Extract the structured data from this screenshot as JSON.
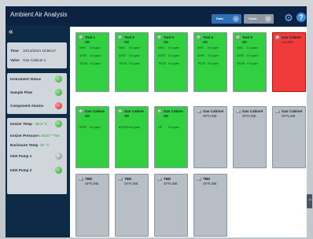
{
  "app": {
    "title": "Ambient Air Analysis"
  },
  "toolbar": {
    "data_label": "Data",
    "chart_label": "Chart"
  },
  "sidebar": {
    "collapse_glyph": "«",
    "time_label": "Time",
    "time_value": "10/13/2024 15:58:47",
    "valve_label": "Valve",
    "valve_value": "Gas Cabinet 1",
    "indicators": [
      {
        "label": "Instrument Status",
        "state": "green"
      },
      {
        "label": "Sample Flow",
        "state": "green"
      },
      {
        "label": "Component Alarms",
        "state": "red"
      }
    ],
    "ionizer_temp_label": "Ionizer Temp",
    "ionizer_temp_value": "88.8 °C",
    "ionizer_pressure_label": "Ionizer Pressure",
    "ionizer_pressure_value": "1.9x10⁻⁶ Torr",
    "enclosure_temp_label": "Enclosure Temp",
    "enclosure_temp_value": "35 °C",
    "pumps": [
      {
        "label": "Inlet Pump 1",
        "state": "grey"
      },
      {
        "label": "Inlet Pump 2",
        "state": "green"
      }
    ]
  },
  "tiles": [
    {
      "name": "Tool 1",
      "status": "OK",
      "color": "green",
      "rows": [
        {
          "name": "NH3",
          "value": "0.0 ppm"
        },
        {
          "name": "ATEF",
          "value": "0.0 ppm"
        },
        {
          "name": "TEOS",
          "value": "0.0 ppm"
        }
      ]
    },
    {
      "name": "Tool 2",
      "status": "OK",
      "color": "green",
      "rows": [
        {
          "name": "NH3",
          "value": "0.0 ppm"
        },
        {
          "name": "ATEF",
          "value": "0.0 ppm"
        },
        {
          "name": "TEOS",
          "value": "0.0 ppm"
        }
      ]
    },
    {
      "name": "Tool 3",
      "status": "OK",
      "color": "green",
      "rows": [
        {
          "name": "NH3",
          "value": "0.0 ppm"
        },
        {
          "name": "ATEF",
          "value": "0.0 ppm"
        },
        {
          "name": "TEOS",
          "value": "0.0 ppm"
        }
      ]
    },
    {
      "name": "Tool 4",
      "status": "OK",
      "color": "green",
      "rows": [
        {
          "name": "NH3",
          "value": "0.0 ppm"
        },
        {
          "name": "ATEF",
          "value": "0.0 ppm"
        },
        {
          "name": "TEOS",
          "value": "0.0 ppm"
        }
      ]
    },
    {
      "name": "Tool 5",
      "status": "OK",
      "color": "green",
      "rows": [
        {
          "name": "NH3",
          "value": "0.0 ppm"
        },
        {
          "name": "ATEF",
          "value": "0.0 ppm"
        },
        {
          "name": "TEOS",
          "value": "0.0 ppm"
        }
      ]
    },
    {
      "name": "Gas Cabine",
      "status": "ALARM",
      "color": "red",
      "rows": []
    },
    {
      "name": "Gas Cabine",
      "status": "OK",
      "color": "green",
      "rows": [
        {
          "name": "ATEF",
          "value": "0.0 ppm"
        }
      ]
    },
    {
      "name": "Gas Cabine",
      "status": "OK",
      "color": "green",
      "rows": [
        {
          "name": "ATEOS",
          "value": "0.0 ppm"
        }
      ]
    },
    {
      "name": "Gas Cabine",
      "status": "OK",
      "color": "green",
      "rows": [
        {
          "name": "HF",
          "value": "0.0 ppm"
        }
      ]
    },
    {
      "name": "Gas Cabinet",
      "status": "OFFLINE",
      "color": "gray",
      "rows": []
    },
    {
      "name": "Gas Cabinet",
      "status": "OFFLINE",
      "color": "gray",
      "rows": []
    },
    {
      "name": "Gas Cabinet",
      "status": "OFFLINE",
      "color": "gray",
      "rows": []
    },
    {
      "name": "TBD",
      "status": "OFFLINE",
      "color": "gray",
      "rows": []
    },
    {
      "name": "TBD",
      "status": "OFFLINE",
      "color": "gray",
      "rows": []
    },
    {
      "name": "TBD",
      "status": "OFFLINE",
      "color": "gray",
      "rows": []
    },
    {
      "name": "TBD",
      "status": "OFFLINE",
      "color": "gray",
      "rows": []
    }
  ],
  "handle_glyph": "⇔",
  "colors": {
    "ok": "#31d040",
    "alarm": "#f13b3b",
    "offline": "#b7bec5",
    "header": "#0b2340"
  }
}
